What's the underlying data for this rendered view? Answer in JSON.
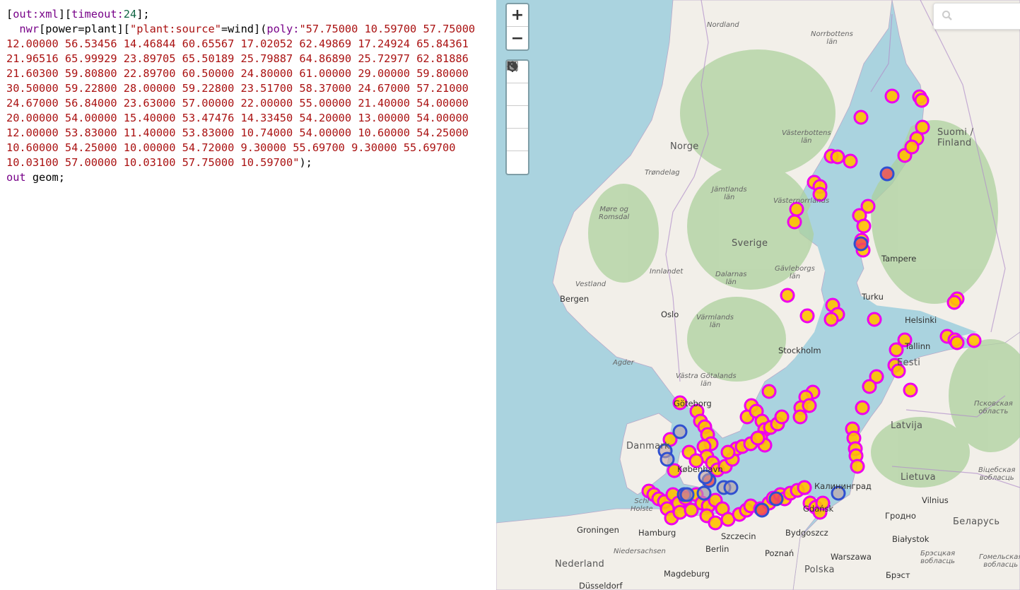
{
  "query": {
    "line1": {
      "p1": "[",
      "p2": "out:xml",
      "p3": "][",
      "p4": "timeout:",
      "p5": "24",
      "p6": "];"
    },
    "line2": {
      "p1": "  ",
      "p2": "nwr",
      "p3": "[power=plant][",
      "p4": "\"plant:source\"",
      "p5": "=wind](",
      "p6": "poly:",
      "p7": "\"57.75000 10.59700 57.75000"
    },
    "coords": [
      "12.00000 56.53456 14.46844 60.65567 17.02052 62.49869 17.24924 65.84361",
      "21.96516 65.99929 23.89705 65.50189 25.79887 64.86890 25.72977 62.81886",
      "21.60300 59.80800 22.89700 60.50000 24.80000 61.00000 29.00000 59.80000",
      "30.50000 59.22800 28.00000 59.22800 23.51700 58.37000 24.67000 57.21000",
      "24.67000 56.84000 23.63000 57.00000 22.00000 55.00000 21.40000 54.00000",
      "20.00000 54.00000 15.40000 53.47476 14.33450 54.20000 13.00000 54.00000",
      "12.00000 53.83000 11.40000 53.83000 10.74000 54.00000 10.60000 54.25000",
      "10.60000 54.25000 10.00000 54.72000 9.30000 55.69700 9.30000 55.69700",
      "10.03100 57.00000 10.03100 57.75000 10.59700\""
    ],
    "line_end": ");",
    "line_last": {
      "p1": "out",
      "p2": " geom;"
    }
  },
  "map": {
    "controls": {
      "zoom_in": "+",
      "zoom_out": "−",
      "tools": [
        "magnifier-icon",
        "crosshair-icon",
        "image-icon",
        "skip-back-icon",
        "no-entry-icon"
      ]
    },
    "colors": {
      "water": "#aad3df",
      "land": "#f2efe9",
      "forest": "#add19e",
      "marker_fill": "#ffc000",
      "marker_stroke": "#ee00ee",
      "marker_fill_red": "#f05050",
      "marker_stroke_blue": "#3050d0"
    },
    "labels": {
      "countries": {
        "norge": "Norge",
        "sverige": "Sverige",
        "suomi": "Suomi /\nFinland",
        "eesti": "Eesti",
        "latvija": "Latvija",
        "lietuva": "Lietuva",
        "polska": "Polska",
        "nederland": "Nederland",
        "danmark": "Danmark",
        "belarus": "Беларусь"
      },
      "regions": {
        "nordland": "Nordland",
        "norrbotten": "Norrbottens\nlän",
        "vasterbotten": "Västerbottens\nlän",
        "trondelag": "Trøndelag",
        "jamtland": "Jämtlands\nlän",
        "vasternorrland": "Västernorrlands",
        "more": "Møre og\nRomsdal",
        "innlandet": "Innlandet",
        "dalarna": "Dalarnas\nlän",
        "gavleborg": "Gävleborgs\nlän",
        "vestland": "Vestland",
        "varmland": "Värmlands\nlän",
        "agder": "Agder",
        "vastra": "Västra Götalands\nlän",
        "pskov": "Псковская\nобласть",
        "vitebsk": "Віцебская\nвобласць",
        "grodno": "Гродно",
        "brest": "Брэсцкая\nвобласць",
        "gomel": "Гомельская\nвобласць",
        "niedersachsen": "Niedersachsen",
        "schleswig": "Schl\nHolste"
      },
      "cities": {
        "bergen": "Bergen",
        "oslo": "Oslo",
        "stockholm": "Stockholm",
        "tampere": "Tampere",
        "turku": "Turku",
        "helsinki": "Helsinki",
        "tallinn": "Tallinn",
        "goteborg": "Göteborg",
        "kobenhavn": "København",
        "kaliningrad": "Калининград",
        "vilnius": "Vilnius",
        "groningen": "Groningen",
        "hamburg": "Hamburg",
        "szczecin": "Szczecin",
        "bydgoszcz": "Bydgoszcz",
        "gdansk": "Gdańsk",
        "berlin": "Berlin",
        "poznan": "Poznań",
        "warszawa": "Warszawa",
        "bialystok": "Białystok",
        "brest_city": "Брэст",
        "magdeburg": "Magdeburg",
        "dusseldorf": "Düsseldorf"
      }
    }
  }
}
